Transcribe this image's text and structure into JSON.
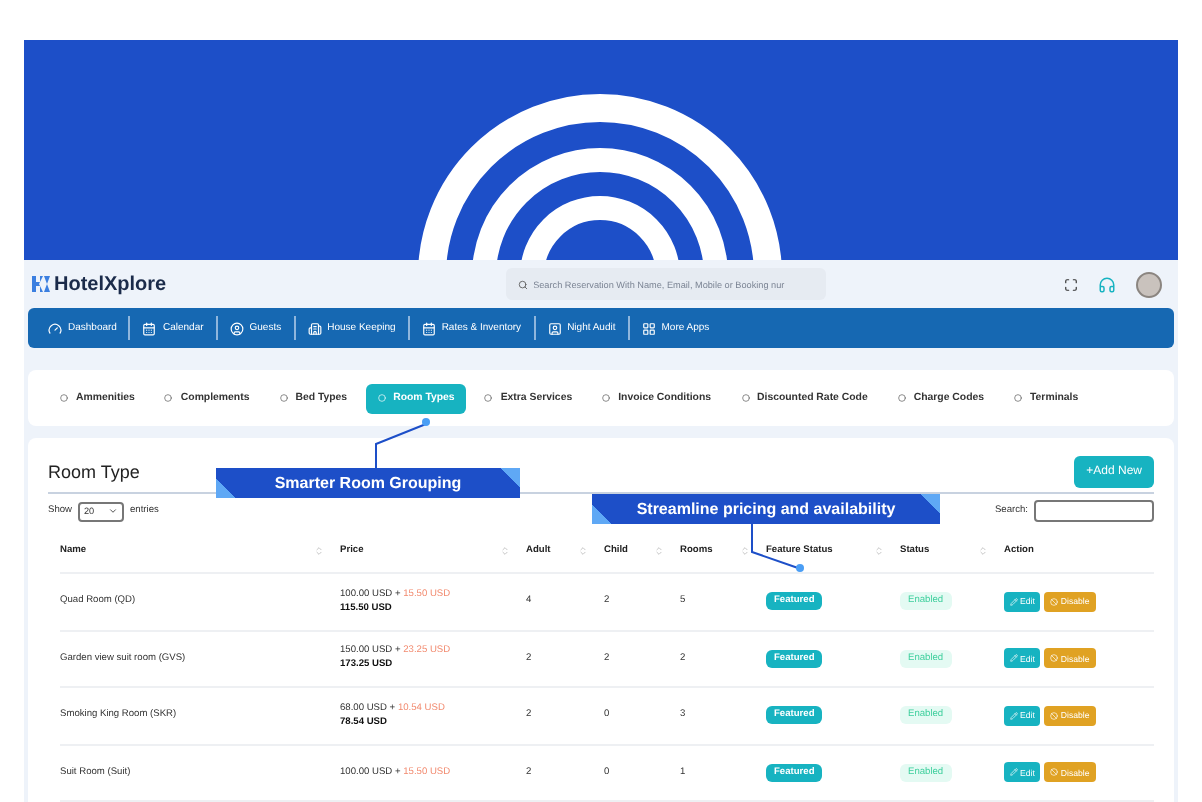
{
  "app": {
    "logo": "HotelXplore",
    "search": {
      "placeholder": "Search Reservation With Name, Email, Mobile or Booking nur"
    }
  },
  "nav": [
    {
      "label": "Dashboard",
      "kind": "gauge"
    },
    {
      "label": "Calendar",
      "kind": "calendar"
    },
    {
      "label": "Guests",
      "kind": "user"
    },
    {
      "label": "House Keeping",
      "kind": "building"
    },
    {
      "label": "Rates & Inventory",
      "kind": "calendar"
    },
    {
      "label": "Night Audit",
      "kind": "badge"
    },
    {
      "label": "More Apps",
      "kind": "grid"
    }
  ],
  "tabs": [
    {
      "label": "Ammenities",
      "selected": false
    },
    {
      "label": "Complements",
      "selected": false
    },
    {
      "label": "Bed Types",
      "selected": false
    },
    {
      "label": "Room Types",
      "selected": true
    },
    {
      "label": "Extra Services",
      "selected": false
    },
    {
      "label": "Invoice Conditions",
      "selected": false
    },
    {
      "label": "Discounted Rate Code",
      "selected": false
    },
    {
      "label": "Charge Codes",
      "selected": false
    },
    {
      "label": "Terminals",
      "selected": false
    }
  ],
  "page": {
    "title": "Room Type",
    "add_button": "+Add New"
  },
  "callouts": [
    {
      "text": "Smarter Room Grouping"
    },
    {
      "text": "Streamline pricing and availability"
    }
  ],
  "entries": {
    "show": "Show",
    "value": "20",
    "suffix": "entries",
    "search_label": "Search:"
  },
  "table": {
    "columns": [
      "Name",
      "Price",
      "Adult",
      "Child",
      "Rooms",
      "Feature Status",
      "Status",
      "Action"
    ],
    "rows": [
      {
        "name": "Quad Room (QD)",
        "base": "100.00 USD +",
        "extra": "15.50 USD",
        "total": "115.50 USD",
        "adult": "4",
        "child": "2",
        "rooms": "5",
        "feature": "Featured",
        "status": "Enabled",
        "edit": "Edit",
        "disable": "Disable"
      },
      {
        "name": "Garden view suit room (GVS)",
        "base": "150.00 USD +",
        "extra": "23.25 USD",
        "total": "173.25 USD",
        "adult": "2",
        "child": "2",
        "rooms": "2",
        "feature": "Featured",
        "status": "Enabled",
        "edit": "Edit",
        "disable": "Disable"
      },
      {
        "name": "Smoking King Room (SKR)",
        "base": "68.00 USD +",
        "extra": "10.54 USD",
        "total": "78.54 USD",
        "adult": "2",
        "child": "0",
        "rooms": "3",
        "feature": "Featured",
        "status": "Enabled",
        "edit": "Edit",
        "disable": "Disable"
      },
      {
        "name": "Suit Room (Suit)",
        "base": "100.00 USD +",
        "extra": "15.50 USD",
        "adult": "2",
        "child": "0",
        "rooms": "1",
        "feature": "Featured",
        "status": "Enabled",
        "edit": "Edit",
        "disable": "Disable"
      }
    ]
  }
}
